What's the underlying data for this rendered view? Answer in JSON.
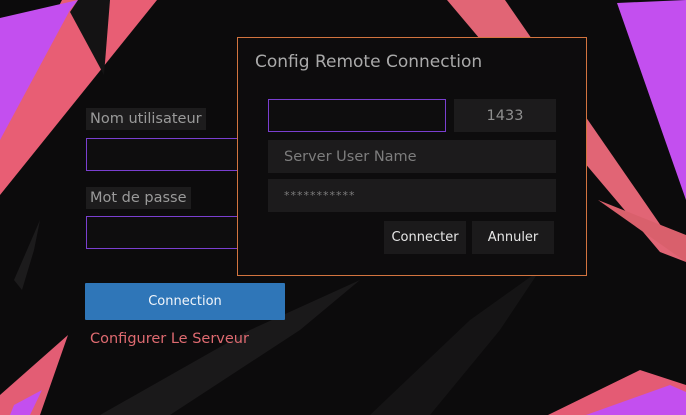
{
  "login": {
    "username_label": "Nom utilisateur",
    "password_label": "Mot de passe",
    "connect_button": "Connection",
    "configure_link": "Configurer Le Serveur"
  },
  "dialog": {
    "title": "Config Remote Connection",
    "host_value": "",
    "port_value": "1433",
    "user_placeholder": "Server User Name",
    "password_value": "***********",
    "connect_button": "Connecter",
    "cancel_button": "Annuler"
  },
  "colors": {
    "background": "#0c0b0c",
    "accent_purple": "#c651f0",
    "accent_pink": "#ea5f75",
    "input_border": "#7a3fd0",
    "dialog_border": "#d3743f",
    "primary_button": "#2f76b8",
    "link": "#de6a70"
  }
}
